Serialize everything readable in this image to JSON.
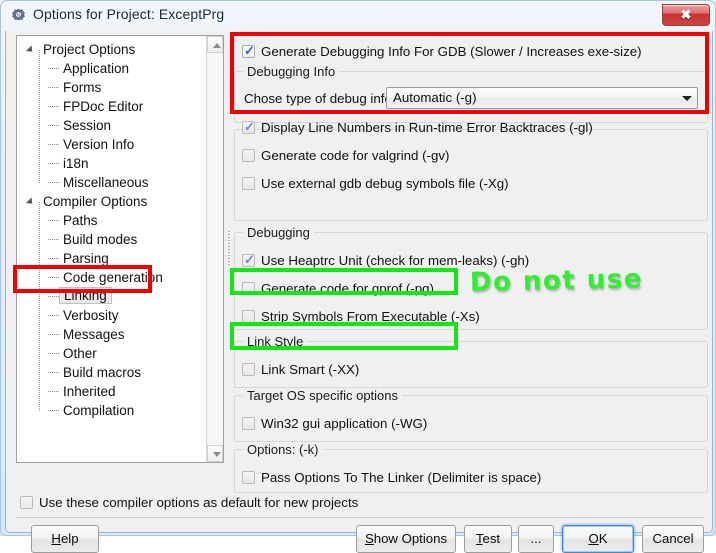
{
  "window": {
    "title": "Options for Project: ExceptPrg",
    "icon": "gear-icon",
    "close_label": "✖"
  },
  "tree": {
    "nodes": [
      {
        "label": "Project Options",
        "level": 0,
        "expanded": true,
        "selected": false
      },
      {
        "label": "Application",
        "level": 1,
        "selected": false
      },
      {
        "label": "Forms",
        "level": 1,
        "selected": false
      },
      {
        "label": "FPDoc Editor",
        "level": 1,
        "selected": false
      },
      {
        "label": "Session",
        "level": 1,
        "selected": false
      },
      {
        "label": "Version Info",
        "level": 1,
        "selected": false
      },
      {
        "label": "i18n",
        "level": 1,
        "selected": false
      },
      {
        "label": "Miscellaneous",
        "level": 1,
        "selected": false
      },
      {
        "label": "Compiler Options",
        "level": 0,
        "expanded": true,
        "selected": false
      },
      {
        "label": "Paths",
        "level": 1,
        "selected": false
      },
      {
        "label": "Build modes",
        "level": 1,
        "selected": false
      },
      {
        "label": "Parsing",
        "level": 1,
        "selected": false
      },
      {
        "label": "Code generation",
        "level": 1,
        "selected": false
      },
      {
        "label": "Linking",
        "level": 1,
        "selected": true
      },
      {
        "label": "Verbosity",
        "level": 1,
        "selected": false
      },
      {
        "label": "Messages",
        "level": 1,
        "selected": false
      },
      {
        "label": "Other",
        "level": 1,
        "selected": false
      },
      {
        "label": "Build macros",
        "level": 1,
        "selected": false
      },
      {
        "label": "Inherited",
        "level": 1,
        "selected": false
      },
      {
        "label": "Compilation",
        "level": 1,
        "selected": false
      }
    ]
  },
  "pane": {
    "generate_debug_info": {
      "label": "Generate Debugging Info For GDB (Slower / Increases exe-size)",
      "checked": true,
      "disabled": false
    },
    "debugging_info_group": {
      "title": "Debugging Info",
      "combo_label": "Chose type of debug info",
      "combo_value": "Automatic (-g)"
    },
    "display_line_numbers": {
      "label": "Display Line Numbers in Run-time Error Backtraces (-gl)",
      "checked": true,
      "disabled": true
    },
    "generate_valgrind": {
      "label": "Generate code for valgrind (-gv)",
      "checked": false,
      "disabled": true
    },
    "use_external_gdb": {
      "label": "Use external gdb debug symbols file (-Xg)",
      "checked": false,
      "disabled": true
    },
    "debugging_group": {
      "title": "Debugging",
      "heaptrc": {
        "label": "Use Heaptrc Unit (check for mem-leaks) (-gh)",
        "checked": true,
        "disabled": true
      },
      "gprof": {
        "label": "Generate code for gprof (-pg)",
        "checked": false,
        "disabled": true
      },
      "strip_symbols": {
        "label": "Strip Symbols From Executable (-Xs)",
        "checked": false,
        "disabled": true
      }
    },
    "link_style_group": {
      "title": "Link Style",
      "link_smart": {
        "label": "Link Smart (-XX)",
        "checked": false,
        "disabled": true
      }
    },
    "target_os_group": {
      "title": "Target OS specific options",
      "win32_gui": {
        "label": "Win32 gui application (-WG)",
        "checked": false,
        "disabled": true
      }
    },
    "options_group": {
      "title": "Options:  (-k)",
      "pass_options": {
        "label": "Pass Options To The Linker (Delimiter is space)",
        "checked": false,
        "disabled": true
      }
    }
  },
  "footer": {
    "use_as_default": {
      "label": "Use these compiler options as default for new projects",
      "checked": false,
      "disabled": true
    },
    "buttons": [
      {
        "name": "help",
        "pre": "",
        "accel": "H",
        "post": "elp",
        "focused": false
      },
      {
        "name": "show-options",
        "pre": "",
        "accel": "S",
        "post": "how Options",
        "focused": false
      },
      {
        "name": "test",
        "pre": "",
        "accel": "T",
        "post": "est",
        "focused": false
      },
      {
        "name": "ellipsis",
        "pre": "...",
        "accel": "",
        "post": "",
        "focused": false
      },
      {
        "name": "ok",
        "pre": "",
        "accel": "O",
        "post": "K",
        "focused": true
      },
      {
        "name": "cancel",
        "pre": "Cancel",
        "accel": "",
        "post": "",
        "focused": false
      }
    ]
  },
  "annotations": {
    "do_not_use_text": "Do not use",
    "red_color": "#ee0000",
    "green_color": "#14e614"
  }
}
